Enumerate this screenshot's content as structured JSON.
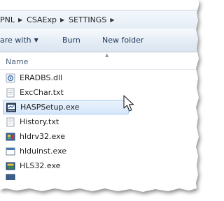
{
  "breadcrumb": [
    {
      "label": "PNL"
    },
    {
      "label": "CSAExp"
    },
    {
      "label": "SETTINGS"
    }
  ],
  "toolbar": {
    "share_label": "are with",
    "burn_label": "Burn",
    "new_folder_label": "New folder"
  },
  "columns": {
    "name": "Name"
  },
  "files": [
    {
      "name": "ERADBS.dll",
      "icon": "dll-gear-icon"
    },
    {
      "name": "ExcChar.txt",
      "icon": "text-file-icon"
    },
    {
      "name": "HASPSetup.exe",
      "icon": "setup-exe-icon",
      "selected": true
    },
    {
      "name": "History.txt",
      "icon": "text-file-icon"
    },
    {
      "name": "hldrv32.exe",
      "icon": "exe-icon"
    },
    {
      "name": "hlduinst.exe",
      "icon": "window-exe-icon"
    },
    {
      "name": "HLS32.exe",
      "icon": "exe-icon"
    }
  ],
  "colors": {
    "selection_bg": "#d7e7fb",
    "selection_border": "#a9c7ee",
    "toolbar_text": "#1e395b"
  }
}
